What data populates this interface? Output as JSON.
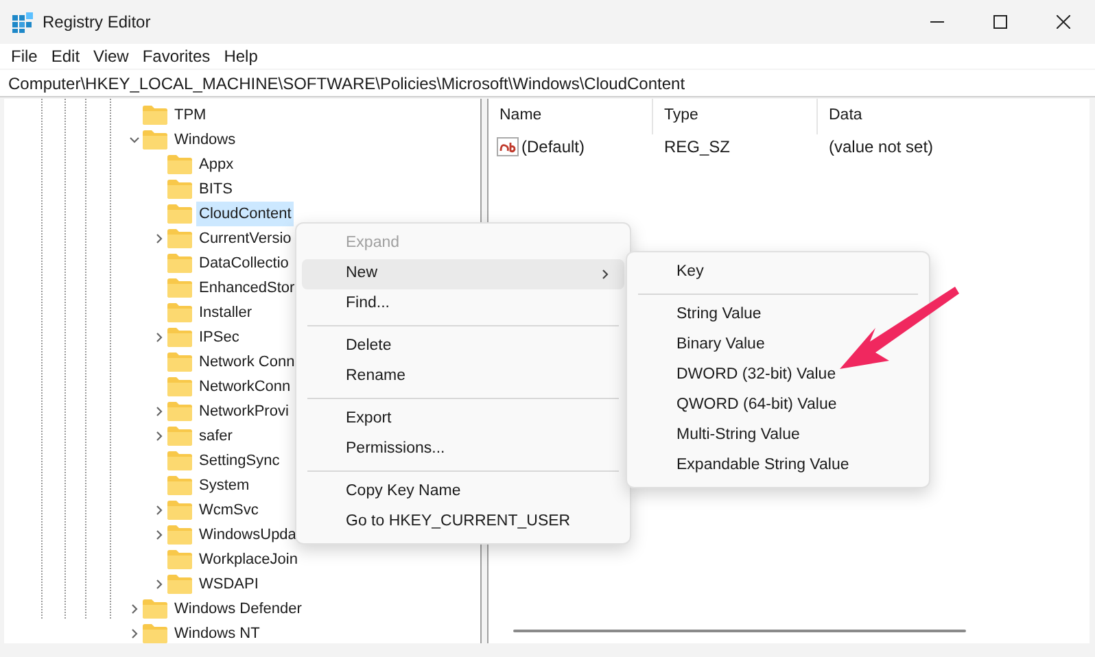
{
  "window": {
    "title": "Registry Editor"
  },
  "menu_bar": [
    "File",
    "Edit",
    "View",
    "Favorites",
    "Help"
  ],
  "address": "Computer\\HKEY_LOCAL_MACHINE\\SOFTWARE\\Policies\\Microsoft\\Windows\\CloudContent",
  "tree": [
    {
      "label": "TPM",
      "expandable": false,
      "selected": false
    },
    {
      "label": "Windows",
      "expandable": true,
      "selected": false,
      "children": [
        {
          "label": "Appx",
          "expandable": false,
          "selected": false
        },
        {
          "label": "BITS",
          "expandable": false,
          "selected": false
        },
        {
          "label": "CloudContent",
          "expandable": false,
          "selected": true
        },
        {
          "label": "CurrentVersio",
          "expandable": true,
          "selected": false
        },
        {
          "label": "DataCollectio",
          "expandable": false,
          "selected": false
        },
        {
          "label": "EnhancedStor",
          "expandable": false,
          "selected": false
        },
        {
          "label": "Installer",
          "expandable": false,
          "selected": false
        },
        {
          "label": "IPSec",
          "expandable": true,
          "selected": false
        },
        {
          "label": "Network Conn",
          "expandable": false,
          "selected": false
        },
        {
          "label": "NetworkConn",
          "expandable": false,
          "selected": false
        },
        {
          "label": "NetworkProvi",
          "expandable": true,
          "selected": false
        },
        {
          "label": "safer",
          "expandable": true,
          "selected": false
        },
        {
          "label": "SettingSync",
          "expandable": false,
          "selected": false
        },
        {
          "label": "System",
          "expandable": false,
          "selected": false
        },
        {
          "label": "WcmSvc",
          "expandable": true,
          "selected": false
        },
        {
          "label": "WindowsUpda",
          "expandable": true,
          "selected": false
        },
        {
          "label": "WorkplaceJoin",
          "expandable": false,
          "selected": false
        },
        {
          "label": "WSDAPI",
          "expandable": true,
          "selected": false
        }
      ]
    },
    {
      "label": "Windows Defender",
      "expandable": true,
      "selected": false
    },
    {
      "label": "Windows NT",
      "expandable": true,
      "selected": false
    }
  ],
  "values": {
    "columns": [
      "Name",
      "Type",
      "Data"
    ],
    "rows": [
      {
        "name": "(Default)",
        "type": "REG_SZ",
        "data": "(value not set)"
      }
    ]
  },
  "context_menu": [
    {
      "kind": "item",
      "label": "Expand",
      "disabled": true,
      "selected": false,
      "submenu": false
    },
    {
      "kind": "item",
      "label": "New",
      "disabled": false,
      "selected": true,
      "submenu": true
    },
    {
      "kind": "item",
      "label": "Find...",
      "disabled": false,
      "selected": false,
      "submenu": false
    },
    {
      "kind": "separator"
    },
    {
      "kind": "item",
      "label": "Delete",
      "disabled": false,
      "selected": false,
      "submenu": false
    },
    {
      "kind": "item",
      "label": "Rename",
      "disabled": false,
      "selected": false,
      "submenu": false
    },
    {
      "kind": "separator"
    },
    {
      "kind": "item",
      "label": "Export",
      "disabled": false,
      "selected": false,
      "submenu": false
    },
    {
      "kind": "item",
      "label": "Permissions...",
      "disabled": false,
      "selected": false,
      "submenu": false
    },
    {
      "kind": "separator"
    },
    {
      "kind": "item",
      "label": "Copy Key Name",
      "disabled": false,
      "selected": false,
      "submenu": false
    },
    {
      "kind": "item",
      "label": "Go to HKEY_CURRENT_USER",
      "disabled": false,
      "selected": false,
      "submenu": false
    }
  ],
  "submenu": [
    {
      "kind": "item",
      "label": "Key"
    },
    {
      "kind": "separator"
    },
    {
      "kind": "item",
      "label": "String Value"
    },
    {
      "kind": "item",
      "label": "Binary Value"
    },
    {
      "kind": "item",
      "label": "DWORD (32-bit) Value"
    },
    {
      "kind": "item",
      "label": "QWORD (64-bit) Value"
    },
    {
      "kind": "item",
      "label": "Multi-String Value"
    },
    {
      "kind": "item",
      "label": "Expandable String Value"
    }
  ]
}
